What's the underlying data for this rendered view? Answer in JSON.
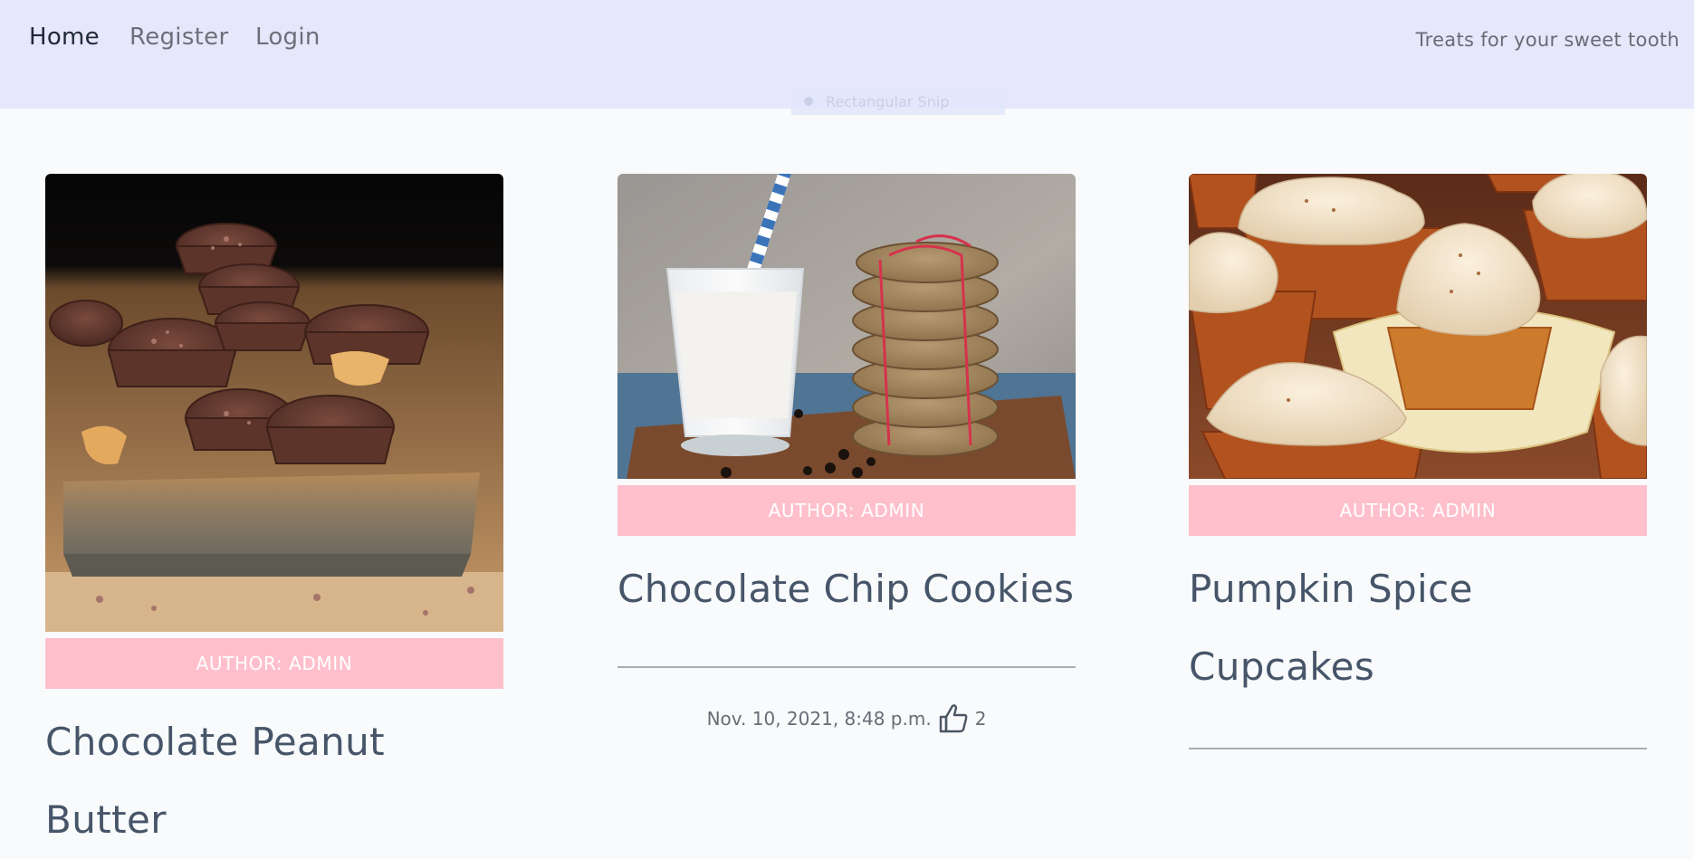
{
  "nav": {
    "links": [
      {
        "label": "Home"
      },
      {
        "label": "Register"
      },
      {
        "label": "Login"
      }
    ],
    "tagline": "Treats for your sweet tooth"
  },
  "overlay": {
    "label": "Rectangular Snip"
  },
  "posts": [
    {
      "author": "AUTHOR: ADMIN",
      "title": "Chocolate Peanut Butter"
    },
    {
      "author": "AUTHOR: ADMIN",
      "title": "Chocolate Chip Cookies",
      "date": "Nov. 10, 2021, 8:48 p.m.",
      "likes": "2"
    },
    {
      "author": "AUTHOR: ADMIN",
      "title_line1": "Pumpkin Spice",
      "title_line2": "Cupcakes"
    }
  ],
  "colors": {
    "navbar_bg": "#e6e7fb",
    "author_bar": "#ffc0cb",
    "title_text": "#475569",
    "page_bg": "#f8fafc"
  },
  "icons": [
    "thumbs-up-icon"
  ]
}
